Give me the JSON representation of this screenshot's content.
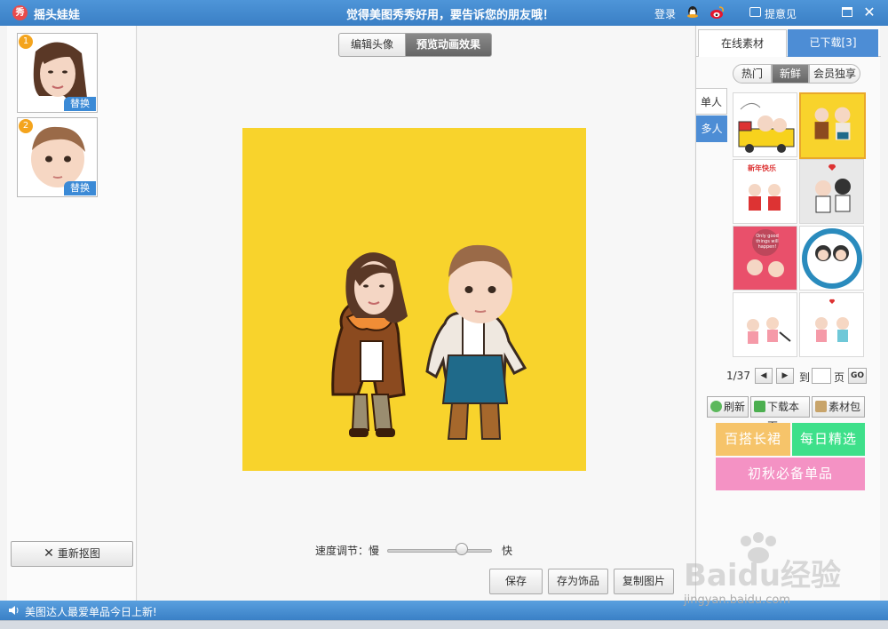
{
  "titlebar": {
    "app_icon": "秀",
    "app_title": "摇头娃娃",
    "slogan": "觉得美图秀秀好用，要告诉您的朋友哦！",
    "login": "登录",
    "feedback": "提意见"
  },
  "left": {
    "faces": [
      {
        "number": "1",
        "replace_label": "替换"
      },
      {
        "number": "2",
        "replace_label": "替换"
      }
    ],
    "rescan_label": "重新抠图"
  },
  "center": {
    "tab_edit": "编辑头像",
    "tab_preview": "预览动画效果",
    "speed_label": "速度调节：慢",
    "speed_fast": "快",
    "speed_level": 0.7,
    "save": "保存",
    "save_as_accessory": "存为饰品",
    "copy_image": "复制图片"
  },
  "right": {
    "tab_online": "在线素材",
    "tab_downloaded": "已下载[3]",
    "filter_hot": "热门",
    "filter_new": "新鲜",
    "filter_vip": "会员独享",
    "side_single": "单人",
    "side_multi": "多人",
    "thumb_caption_newyear": "新年快乐",
    "thumb_caption_happy": "Only good things will happen!",
    "page_info": "1/37",
    "to_label": "到",
    "page_label": "页",
    "go": "GO",
    "refresh": "刷新",
    "download_page": "下载本页",
    "material_pack": "素材包",
    "banner1": "百搭长裙",
    "banner2": "每日精选",
    "banner3": "初秋必备单品"
  },
  "status": {
    "text": "美图达人最爱单品今日上新!"
  },
  "watermark": {
    "brand": "Baidu经验",
    "url": "jingyan.baidu.com"
  }
}
